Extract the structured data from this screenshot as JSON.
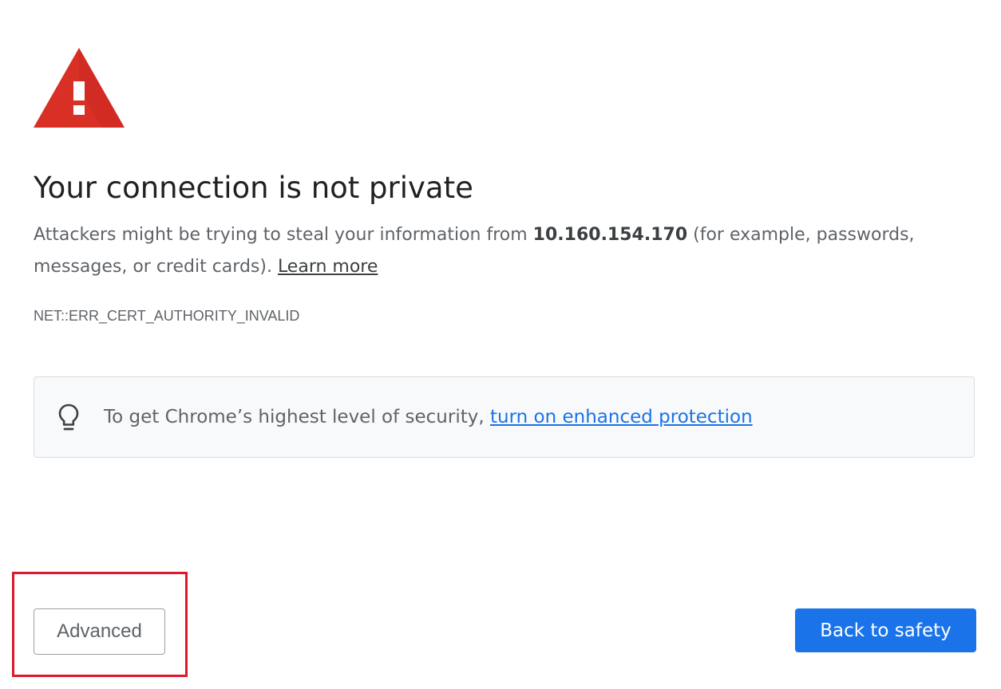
{
  "page": {
    "icon": "warning-icon",
    "title": "Your connection is not private",
    "explanation": {
      "before": "Attackers might be trying to steal your information from ",
      "host": "10.160.154.170",
      "after": " (for example, passwords, messages, or credit cards). ",
      "learn_more": "Learn more"
    },
    "error_code": "NET::ERR_CERT_AUTHORITY_INVALID"
  },
  "promo": {
    "icon": "lightbulb-icon",
    "text": "To get Chrome’s highest level of security, ",
    "link": "turn on enhanced protection"
  },
  "buttons": {
    "advanced": "Advanced",
    "back_to_safety": "Back to safety"
  },
  "colors": {
    "warning_red": "#d93025",
    "link_blue": "#1a73e8",
    "primary_button": "#1a73e8",
    "highlight_box": "#e0182d",
    "promo_background": "#f8f9fa"
  }
}
